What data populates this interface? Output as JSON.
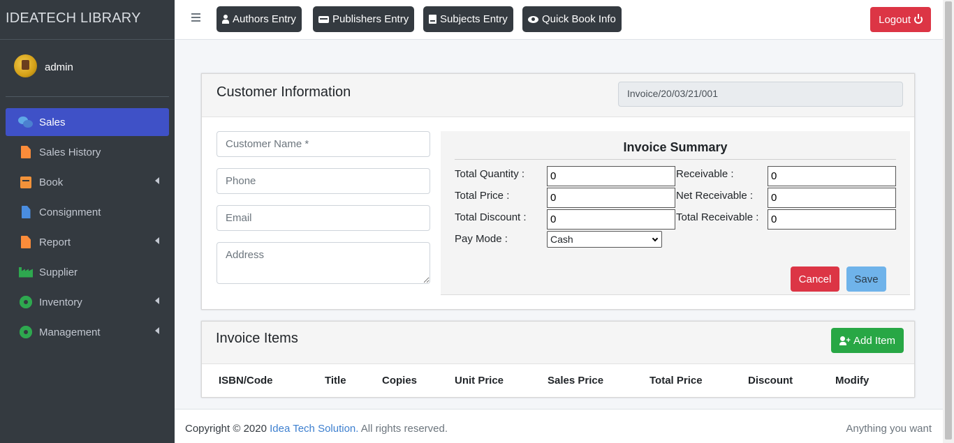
{
  "brand": {
    "title": "IDEATECH LIBRARY"
  },
  "user": {
    "name": "admin"
  },
  "sidebar": {
    "items": [
      {
        "label": "Sales",
        "icon": "chat-icon"
      },
      {
        "label": "Sales History",
        "icon": "document-icon"
      },
      {
        "label": "Book",
        "icon": "book-icon"
      },
      {
        "label": "Consignment",
        "icon": "file-dollar-icon"
      },
      {
        "label": "Report",
        "icon": "document-icon"
      },
      {
        "label": "Supplier",
        "icon": "factory-icon"
      },
      {
        "label": "Inventory",
        "icon": "gear-icon"
      },
      {
        "label": "Management",
        "icon": "gear-icon"
      }
    ]
  },
  "topbar": {
    "authors": "Authors Entry",
    "publishers": "Publishers Entry",
    "subjects": "Subjects Entry",
    "quickbook": "Quick Book Info",
    "logout": "Logout"
  },
  "customer": {
    "title": "Customer Information",
    "invoice_no": "Invoice/20/03/21/001",
    "name_placeholder": "Customer Name *",
    "phone_placeholder": "Phone",
    "email_placeholder": "Email",
    "address_placeholder": "Address"
  },
  "summary": {
    "title": "Invoice Summary",
    "total_quantity_label": "Total Quantity :",
    "total_quantity": "0",
    "total_price_label": "Total Price :",
    "total_price": "0",
    "total_discount_label": "Total Discount :",
    "total_discount": "0",
    "receivable_label": "Receivable :",
    "receivable": "0",
    "net_receivable_label": "Net Receivable :",
    "net_receivable": "0",
    "total_receivable_label": "Total Receivable :",
    "total_receivable": "0",
    "pay_mode_label": "Pay Mode :",
    "pay_mode": "Cash",
    "cancel": "Cancel",
    "save": "Save"
  },
  "items": {
    "title": "Invoice Items",
    "add_label": "Add Item",
    "columns": [
      "ISBN/Code",
      "Title",
      "Copies",
      "Unit Price",
      "Sales Price",
      "Total Price",
      "Discount",
      "Modify"
    ]
  },
  "footer": {
    "copyright": "Copyright © 2020",
    "company": "Idea Tech Solution.",
    "rights": " All rights reserved.",
    "right_text": "Anything you want"
  },
  "colors": {
    "sidebar": "#343a40",
    "active": "#3f51c7",
    "danger": "#dc3545",
    "success": "#28a745"
  }
}
